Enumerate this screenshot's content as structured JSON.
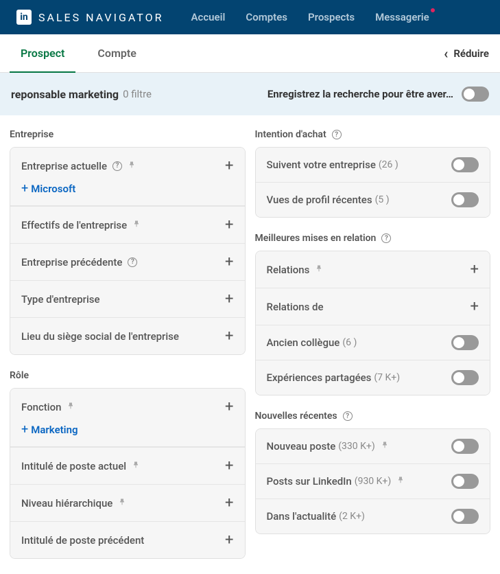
{
  "topbar": {
    "brand": "SALES NAVIGATOR",
    "nav": [
      "Accueil",
      "Comptes",
      "Prospects",
      "Messagerie"
    ]
  },
  "tabs": {
    "prospect": "Prospect",
    "compte": "Compte",
    "reduce": "Réduire"
  },
  "search": {
    "term": "reponsable marketing",
    "filter_count": "0 filtre",
    "save_label": "Enregistrez la recherche pour être aver…"
  },
  "left": {
    "entreprise": {
      "title": "Entreprise",
      "current": "Entreprise actuelle",
      "current_chip": "Microsoft",
      "headcount": "Effectifs de l'entreprise",
      "previous": "Entreprise précédente",
      "type": "Type d'entreprise",
      "hq": "Lieu du siège social de l'entreprise"
    },
    "role": {
      "title": "Rôle",
      "function": "Fonction",
      "function_chip": "Marketing",
      "title_current": "Intitulé de poste actuel",
      "seniority": "Niveau hiérarchique",
      "title_previous": "Intitulé de poste précédent"
    }
  },
  "right": {
    "intent": {
      "title": "Intention d'achat",
      "follow": "Suivent votre entreprise",
      "follow_count": "(26 )",
      "views": "Vues de profil récentes",
      "views_count": "(5 )"
    },
    "bestpath": {
      "title": "Meilleures mises en relation",
      "relations": "Relations",
      "relations_de": "Relations de",
      "colleague": "Ancien collègue",
      "colleague_count": "(6 )",
      "shared": "Expériences partagées",
      "shared_count": "(7 K+)"
    },
    "news": {
      "title": "Nouvelles récentes",
      "newrole": "Nouveau poste",
      "newrole_count": "(330 K+)",
      "posts": "Posts sur LinkedIn",
      "posts_count": "(930 K+)",
      "innews": "Dans l'actualité",
      "innews_count": "(2 K+)"
    }
  }
}
